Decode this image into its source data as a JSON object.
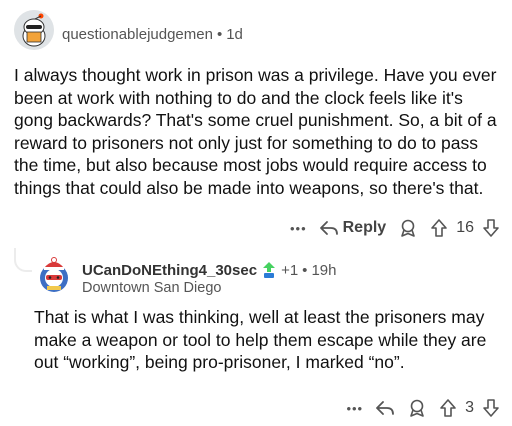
{
  "comment": {
    "author": "questionablejudgemen",
    "age": "1d",
    "separator": "•",
    "body": "I always thought work in prison was a privilege.  Have you ever been at work with nothing to do and the clock feels like it's gong backwards?  That's some cruel punishment.  So, a bit of a reward to prisoners not only just for something to do to pass the time, but also because most jobs would require access to things that could also be made into weapons, so there's that.",
    "actions": {
      "more": "•••",
      "reply_label": "Reply",
      "award_icon": "award-icon",
      "score": "16"
    }
  },
  "reply": {
    "author": "UCanDoNEthing4_30sec",
    "karma_badge": "+1",
    "separator": "•",
    "age": "19h",
    "flair": "Downtown San Diego",
    "body": "That is what I was thinking, well at least the prisoners may make a weapon or tool to help them escape while they are out “working”, being pro-prisoner, I marked “no”.",
    "actions": {
      "more": "•••",
      "reply_icon": "reply-icon",
      "award_icon": "award-icon",
      "score": "3"
    }
  },
  "colors": {
    "text": "#111111",
    "muted": "#555555",
    "thread": "#ececec"
  }
}
